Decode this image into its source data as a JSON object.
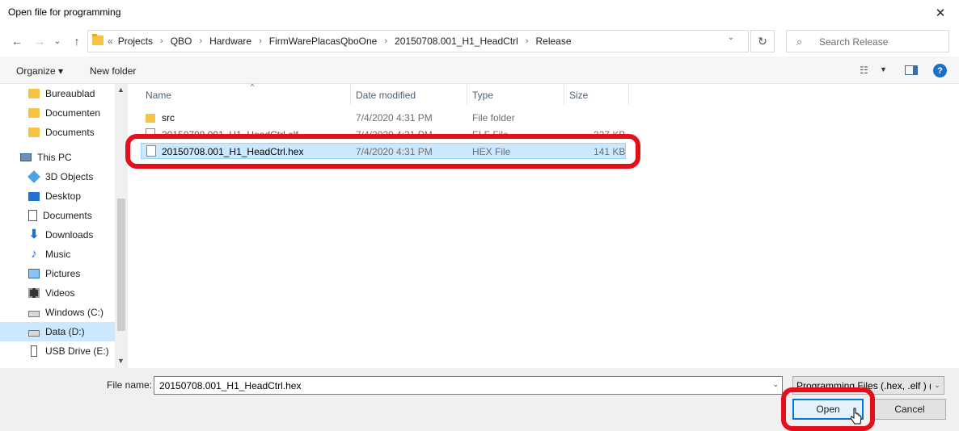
{
  "window": {
    "title": "Open file for programming",
    "close_glyph": "✕"
  },
  "navigation": {
    "back_icon": "arrow-left-icon",
    "forward_icon": "arrow-right-icon",
    "up_icon": "arrow-up-icon",
    "back": "←",
    "forward": "→",
    "dropdown": "⌄",
    "up": "↑"
  },
  "address": {
    "lead": "«",
    "crumbs": [
      "Projects",
      "QBO",
      "Hardware",
      "FirmWarePlacasQboOne",
      "20150708.001_H1_HeadCtrl",
      "Release"
    ],
    "separator": "›",
    "refresh": "↻",
    "dropdown": "⌄"
  },
  "search": {
    "placeholder": "Search Release",
    "icon": "⌕"
  },
  "toolbar": {
    "organize_label": "Organize ▾",
    "new_folder_label": "New folder",
    "view_options": "☷",
    "view_dropdown": "▼",
    "help": "?"
  },
  "nav_pane": {
    "items": [
      {
        "label": "Bureaublad",
        "icon": "folder-icon"
      },
      {
        "label": "Documenten",
        "icon": "folder-icon"
      },
      {
        "label": "Documents",
        "icon": "folder-icon"
      },
      {
        "label": "This PC",
        "icon": "computer-icon"
      },
      {
        "label": "3D Objects",
        "icon": "3d-objects-icon"
      },
      {
        "label": "Desktop",
        "icon": "desktop-icon"
      },
      {
        "label": "Documents",
        "icon": "documents-icon"
      },
      {
        "label": "Downloads",
        "icon": "download-icon"
      },
      {
        "label": "Music",
        "icon": "music-icon"
      },
      {
        "label": "Pictures",
        "icon": "pictures-icon"
      },
      {
        "label": "Videos",
        "icon": "videos-icon"
      },
      {
        "label": "Windows (C:)",
        "icon": "drive-icon"
      },
      {
        "label": "Data (D:)",
        "icon": "drive-icon",
        "selected": true
      },
      {
        "label": "USB Drive (E:)",
        "icon": "usb-drive-icon"
      }
    ],
    "download_glyph": "⬇",
    "music_glyph": "♪",
    "scroll_up": "▲",
    "scroll_down": "▼"
  },
  "file_list": {
    "columns": [
      "Name",
      "Date modified",
      "Type",
      "Size"
    ],
    "sort_indicator": "^",
    "rows": [
      {
        "name": "src",
        "date": "7/4/2020 4:31 PM",
        "type": "File folder",
        "size": ""
      },
      {
        "name": "20150708.001_H1_HeadCtrl.elf",
        "date": "7/4/2020 4:31 PM",
        "type": "ELF File",
        "size": "327 KB"
      },
      {
        "name": "20150708.001_H1_HeadCtrl.hex",
        "date": "7/4/2020 4:31 PM",
        "type": "HEX File",
        "size": "141 KB",
        "selected": true
      }
    ]
  },
  "bottom": {
    "file_name_label": "File name:",
    "file_name_value": "20150708.001_H1_HeadCtrl.hex",
    "file_type_value": "Programming Files (.hex, .elf ) (*.hex;*.elf)",
    "dropdown": "⌄",
    "open_label": "Open",
    "cancel_label": "Cancel"
  },
  "colors": {
    "annotation_red": "#e3101c",
    "selection_blue": "#cce8ff",
    "accent_blue": "#0078d7"
  }
}
